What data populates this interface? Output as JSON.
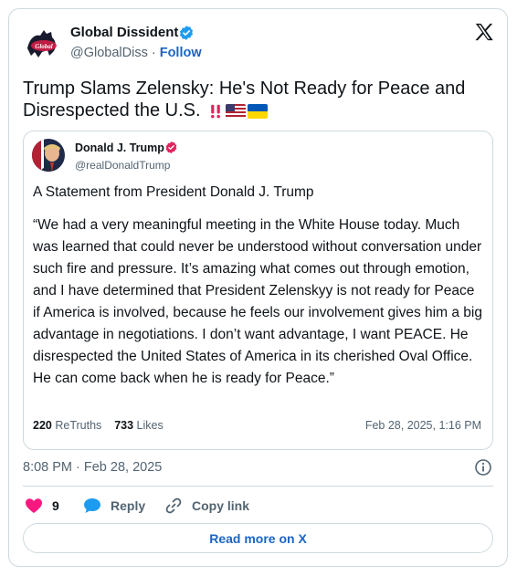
{
  "post": {
    "author_name": "Global Dissident",
    "author_handle": "@GlobalDiss",
    "separator": " · ",
    "follow_label": "Follow",
    "logo_text": "Global Dissident",
    "text": "Trump Slams Zelensky: He's Not Ready for Peace and Disrespected the U.S. ",
    "emoji": [
      "double-exclamation-icon",
      "us-flag-icon",
      "ukraine-flag-icon"
    ],
    "timestamp": "8:08 PM · Feb 28, 2025"
  },
  "quote": {
    "author_name": "Donald J. Trump",
    "author_handle": "@realDonaldTrump",
    "statement": "A Statement from President Donald J. Trump",
    "body": "“We had a very meaningful meeting in the White House today. Much was learned that could never be understood without conversation under such fire and pressure. It’s amazing what comes out through emotion, and I have determined that President Zelenskyy is not ready for Peace if America is involved, because he feels our involvement gives him a big advantage in negotiations. I don’t want advantage, I want PEACE. He disrespected the United States of America in its cherished Oval Office. He can come back when he is ready for Peace.”",
    "retruths_count": "220",
    "retruths_label": "ReTruths",
    "likes_count": "733",
    "likes_label": "Likes",
    "date": "Feb 28, 2025, 1:16 PM"
  },
  "actions": {
    "likes_count": "9",
    "reply_label": "Reply",
    "copy_label": "Copy link"
  },
  "read_more_label": "Read more on X",
  "colors": {
    "accent": "#1d64c3",
    "verified_blue": "#1d9bf0",
    "verified_truth": "#e0245e",
    "heart": "#f91880",
    "text": "#0f1419",
    "secondary": "#536471",
    "border": "#cfd9de"
  }
}
